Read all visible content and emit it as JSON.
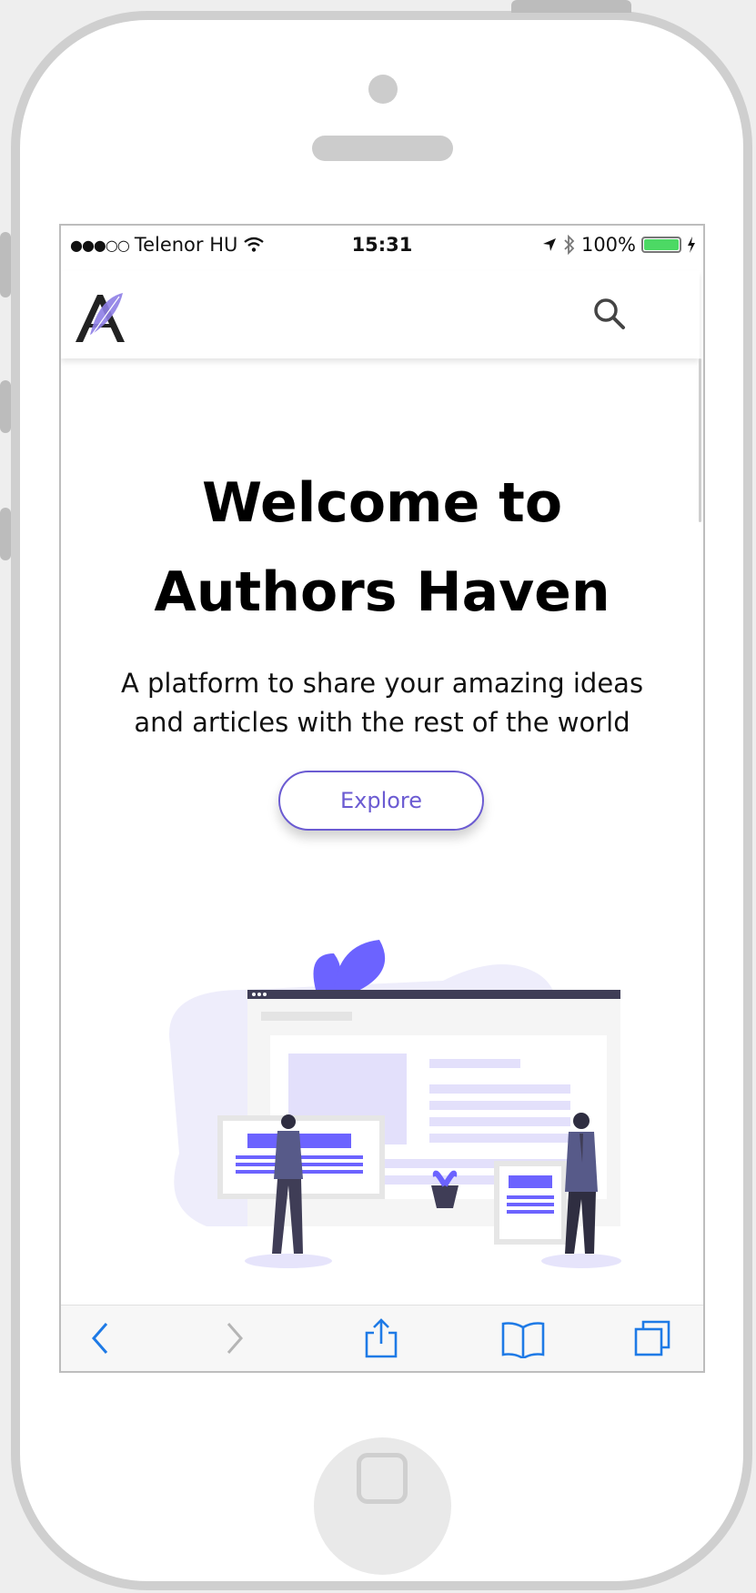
{
  "status_bar": {
    "carrier": "Telenor HU",
    "time": "15:31",
    "battery": "100%"
  },
  "hero": {
    "title_line1": "Welcome to",
    "title_line2": "Authors Haven",
    "subtitle_line1": "A platform to share your amazing ideas",
    "subtitle_line2": "and articles with the rest of the world",
    "explore_label": "Explore"
  },
  "icons": {
    "logo": "feather-a-logo-icon",
    "search": "search-icon",
    "back": "chevron-left-icon",
    "forward": "chevron-right-icon",
    "share": "share-icon",
    "bookmarks": "book-icon",
    "tabs": "tabs-icon"
  },
  "colors": {
    "accent": "#6b5bd2",
    "illustration": "#6c63ff",
    "ios_blue": "#1e7ae6"
  }
}
